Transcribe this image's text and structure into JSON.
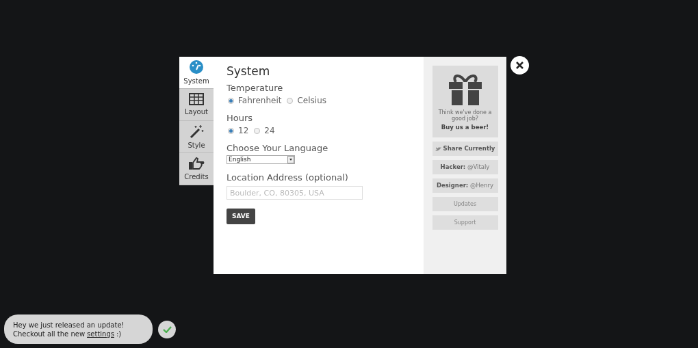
{
  "tabs": [
    {
      "label": "System",
      "kind": "gauge",
      "selected": true
    },
    {
      "label": "Layout",
      "kind": "grid",
      "selected": false
    },
    {
      "label": "Style",
      "kind": "wand",
      "selected": false
    },
    {
      "label": "Credits",
      "kind": "thumb",
      "selected": false
    }
  ],
  "title": "System",
  "temperature": {
    "label": "Temperature",
    "options": [
      {
        "label": "Fahrenheit",
        "selected": true
      },
      {
        "label": "Celsius",
        "selected": false
      }
    ]
  },
  "hours": {
    "label": "Hours",
    "options": [
      {
        "label": "12",
        "selected": true
      },
      {
        "label": "24",
        "selected": false
      }
    ]
  },
  "language": {
    "label": "Choose Your Language",
    "value": "English"
  },
  "location": {
    "label": "Location Address (optional)",
    "placeholder": "Boulder, CO, 80305, USA"
  },
  "save_button": "SAVE",
  "sidebar": {
    "gift_text": "Think we've done a good job?",
    "gift_link": "Buy us a beer!",
    "buttons": [
      {
        "kind": "share",
        "label": "Share Currently"
      },
      {
        "kind": "credit",
        "role": "Hacker:",
        "handle": "@Vitaly"
      },
      {
        "kind": "credit",
        "role": "Designer:",
        "handle": "@Henry"
      },
      {
        "kind": "plain",
        "label": "Updates"
      },
      {
        "kind": "plain",
        "label": "Support"
      }
    ]
  },
  "toast": {
    "line1": "Hey we just released an update!",
    "line2_before": "Checkout all the new",
    "link": "settings",
    "line2_after": ":)"
  }
}
